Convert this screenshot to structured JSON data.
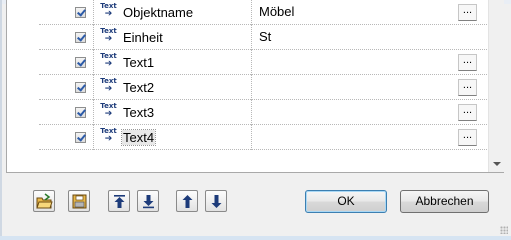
{
  "rows": [
    {
      "name": "Objektname",
      "value": "Möbel",
      "checked": true,
      "icon": "text-arrow-icon",
      "has_ellipsis": true
    },
    {
      "name": "Einheit",
      "value": "St",
      "checked": true,
      "icon": "text-arrow-icon",
      "has_ellipsis": false
    },
    {
      "name": "Text1",
      "value": "",
      "checked": true,
      "icon": "text-arrow-icon",
      "has_ellipsis": true
    },
    {
      "name": "Text2",
      "value": "",
      "checked": true,
      "icon": "text-arrow-icon",
      "has_ellipsis": true
    },
    {
      "name": "Text3",
      "value": "",
      "checked": true,
      "icon": "text-arrow-icon",
      "has_ellipsis": true
    },
    {
      "name": "Text4",
      "value": "",
      "checked": true,
      "icon": "text-arrow-icon",
      "has_ellipsis": true,
      "selected": true
    }
  ],
  "icon_text": "Text",
  "ellipsis_label": "...",
  "toolbar": {
    "icons": [
      "open-folder-icon",
      "save-icon",
      "move-top-icon",
      "move-bottom-icon",
      "move-up-icon",
      "move-down-icon"
    ]
  },
  "buttons": {
    "ok": "OK",
    "cancel": "Abbrechen"
  },
  "colors": {
    "accent": "#3c7fb1",
    "arrow_blue": "#1d3b7a",
    "check_blue": "#2b5aa8"
  }
}
